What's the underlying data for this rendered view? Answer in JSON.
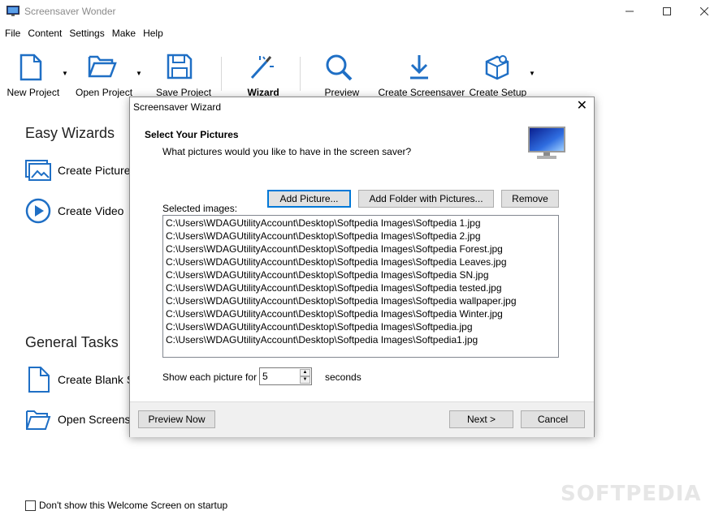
{
  "window": {
    "title": "Screensaver Wonder"
  },
  "menu": [
    "File",
    "Content",
    "Settings",
    "Make",
    "Help"
  ],
  "toolbar": {
    "new_project": "New Project",
    "open_project": "Open Project",
    "save_project": "Save Project",
    "wizard": "Wizard",
    "preview": "Preview",
    "create_screensaver": "Create Screensaver",
    "create_setup": "Create Setup"
  },
  "welcome": {
    "easy_wizards_title": "Easy Wizards",
    "create_picture": "Create Picture",
    "create_video": "Create Video",
    "general_tasks_title": "General Tasks",
    "create_blank": "Create Blank S",
    "open_screensaver": "Open Screens",
    "dont_show": "Don't show this Welcome Screen on startup",
    "dont_show_checked": false
  },
  "watermark": "SOFTPEDIA",
  "dialog": {
    "title": "Screensaver Wizard",
    "close": "✕",
    "heading": "Select Your Pictures",
    "subheading": "What pictures would you like to have in the screen saver?",
    "add_picture": "Add Picture...",
    "add_folder": "Add Folder with Pictures...",
    "remove": "Remove",
    "selected_label": "Selected images:",
    "images": [
      "C:\\Users\\WDAGUtilityAccount\\Desktop\\Softpedia Images\\Softpedia 1.jpg",
      "C:\\Users\\WDAGUtilityAccount\\Desktop\\Softpedia Images\\Softpedia 2.jpg",
      "C:\\Users\\WDAGUtilityAccount\\Desktop\\Softpedia Images\\Softpedia Forest.jpg",
      "C:\\Users\\WDAGUtilityAccount\\Desktop\\Softpedia Images\\Softpedia Leaves.jpg",
      "C:\\Users\\WDAGUtilityAccount\\Desktop\\Softpedia Images\\Softpedia SN.jpg",
      "C:\\Users\\WDAGUtilityAccount\\Desktop\\Softpedia Images\\Softpedia tested.jpg",
      "C:\\Users\\WDAGUtilityAccount\\Desktop\\Softpedia Images\\Softpedia wallpaper.jpg",
      "C:\\Users\\WDAGUtilityAccount\\Desktop\\Softpedia Images\\Softpedia Winter.jpg",
      "C:\\Users\\WDAGUtilityAccount\\Desktop\\Softpedia Images\\Softpedia.jpg",
      "C:\\Users\\WDAGUtilityAccount\\Desktop\\Softpedia Images\\Softpedia1.jpg"
    ],
    "show_each_label": "Show each picture for",
    "show_each_value": "5",
    "seconds_label": "seconds",
    "preview_now": "Preview Now",
    "next": "Next >",
    "cancel": "Cancel"
  },
  "colors": {
    "icon_blue": "#1f6fc5",
    "dialog_default_border": "#0078d7"
  }
}
